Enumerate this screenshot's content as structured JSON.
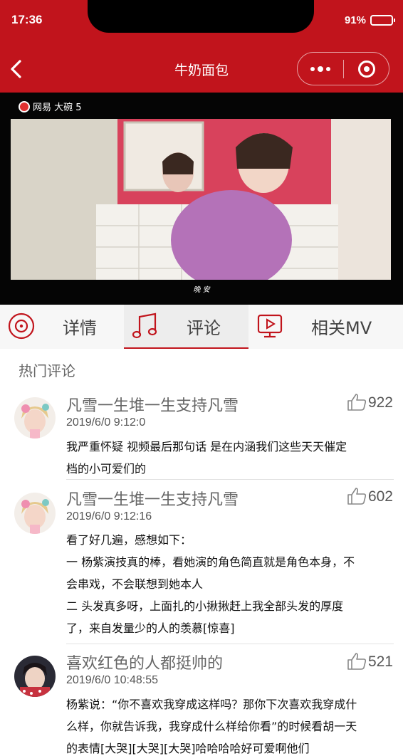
{
  "status_bar": {
    "time": "17:36",
    "battery_text": "91%"
  },
  "nav": {
    "title": "牛奶面包"
  },
  "video": {
    "logo_text": "网易 大碗 5",
    "subtitle": "晚 安"
  },
  "tabs": [
    {
      "label": "详情",
      "icon": "disc-icon"
    },
    {
      "label": "评论",
      "icon": "music-note-icon"
    },
    {
      "label": "相关MV",
      "icon": "video-play-icon"
    }
  ],
  "comments_section": {
    "title": "热门评论",
    "comments": [
      {
        "user": "凡雪一生堆一生支持凡雪",
        "time": "2019/6/0 9:12:0",
        "likes": "922",
        "lines": [
          "我严重怀疑 视频最后那句话 是在内涵我们这些天天催定",
          "档的小可爱们的"
        ]
      },
      {
        "user": "凡雪一生堆一生支持凡雪",
        "time": "2019/6/0 9:12:16",
        "likes": "602",
        "lines": [
          "看了好几遍，感想如下：",
          "一 杨紫演技真的棒，看她演的角色简直就是角色本身，不",
          "会串戏，不会联想到她本人",
          "二 头发真多呀，上面扎的小揪揪赶上我全部头发的厚度",
          "了，来自发量少的人的羡慕[惊喜]"
        ]
      },
      {
        "user": "喜欢红色的人都挺帅的",
        "time": "2019/6/0 10:48:55",
        "likes": "521",
        "lines": [
          "杨紫说：“你不喜欢我穿成这样吗？那你下次喜欢我穿成什",
          "么样，你就告诉我，我穿成什么样给你看”的时候看胡一天",
          "的表情[大哭][大哭][大哭]哈哈哈哈好可爱啊他们"
        ]
      }
    ]
  },
  "colors": {
    "accent": "#c1141c"
  }
}
